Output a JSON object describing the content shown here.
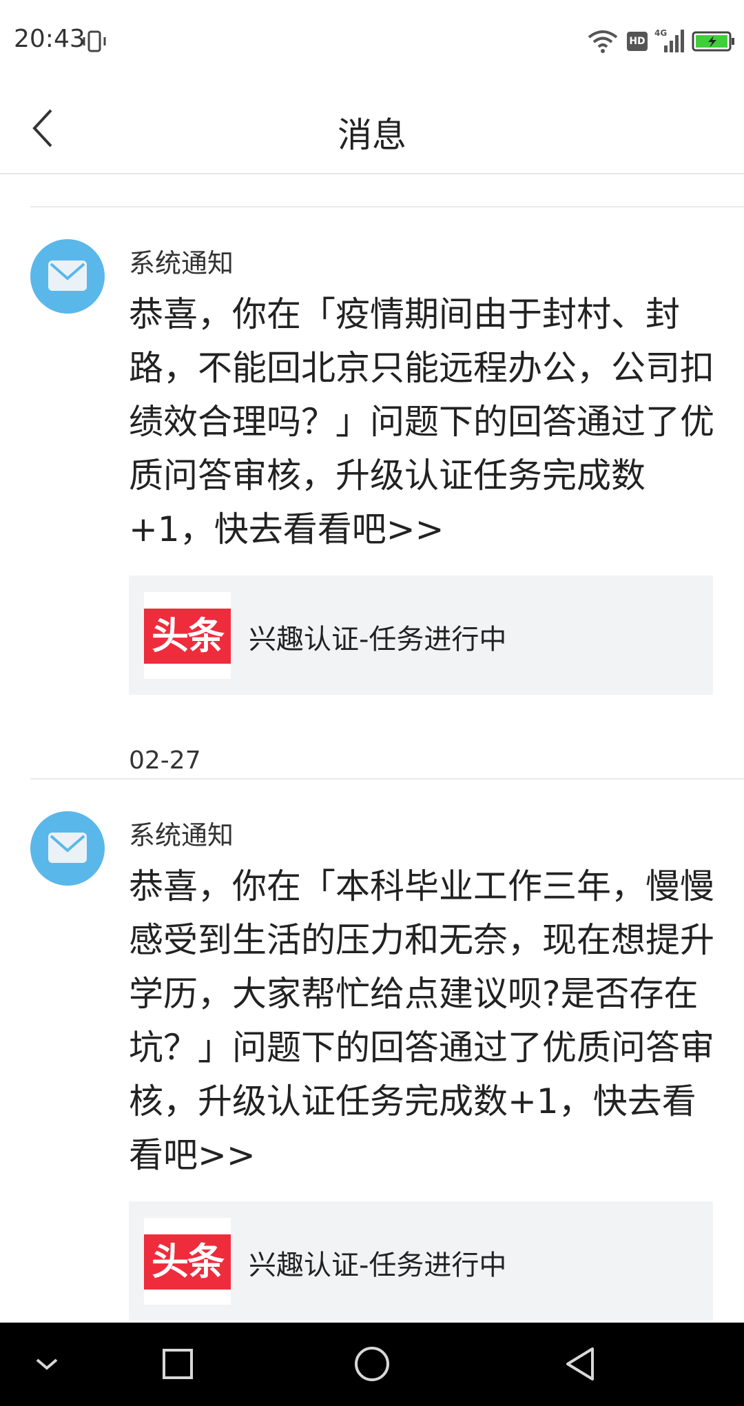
{
  "status_bar": {
    "time": "20:43",
    "icons": [
      "vibrate-icon",
      "wifi-icon",
      "hd-icon",
      "signal-4g-icon",
      "battery-charging-icon"
    ],
    "hd_label": "HD",
    "network_label": "4G"
  },
  "header": {
    "title": "消息",
    "back_icon": "chevron-left-icon"
  },
  "messages": [
    {
      "sender": "系统通知",
      "text": "恭喜，你在「疫情期间由于封村、封路，不能回北京只能远程办公，公司扣绩效合理吗？」问题下的回答通过了优质问答审核，升级认证任务完成数+1，快去看看吧>>",
      "card": {
        "logo_text": "头条",
        "title": "兴趣认证-任务进行中"
      },
      "date": "02-27"
    },
    {
      "sender": "系统通知",
      "text": "恭喜，你在「本科毕业工作三年，慢慢感受到生活的压力和无奈，现在想提升学历，大家帮忙给点建议呗?是否存在坑？」问题下的回答通过了优质问答审核，升级认证任务完成数+1，快去看看吧>>",
      "card": {
        "logo_text": "头条",
        "title": "兴趣认证-任务进行中"
      }
    }
  ],
  "colors": {
    "avatar": "#5ab7ea",
    "card_bg": "#f2f3f5",
    "logo_red": "#ee2c3c",
    "nav_bar": "#000000"
  },
  "nav_bar": {
    "icons": [
      "chevron-down-icon",
      "square-icon",
      "circle-home-icon",
      "triangle-back-icon"
    ]
  }
}
